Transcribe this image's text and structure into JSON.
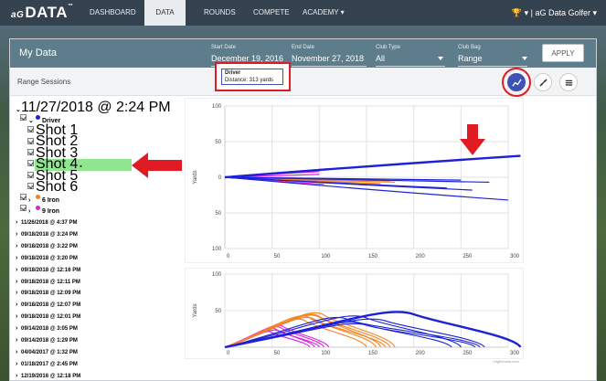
{
  "nav": {
    "logo_small": "aG",
    "logo_main": "DATA",
    "logo_mark": "™",
    "items": [
      "DASHBOARD",
      "DATA",
      "ROUNDS",
      "COMPETE",
      "ACADEMY ▾"
    ],
    "active_index": 1,
    "user": "🏆 ▾ | aG Data Golfer ▾"
  },
  "header": {
    "title": "My Data",
    "start_label": "Start Date",
    "start_value": "December 19, 2016",
    "end_label": "End Date",
    "end_value": "November 27, 2018",
    "club_type_label": "Club Type",
    "club_type_value": "All",
    "club_bag_label": "Club Bag",
    "club_bag_value": "Range",
    "apply_label": "APPLY"
  },
  "subbar": {
    "label": "Range Sessions",
    "icons": [
      "line-chart-icon",
      "scatter-icon",
      "list-icon"
    ]
  },
  "tree": {
    "session": "11/27/2018 @ 2:24 PM",
    "driver_label": "Driver",
    "shots": [
      "Shot 1",
      "Shot 2",
      "Shot 3",
      "Shot 4",
      "Shot 5",
      "Shot 6"
    ],
    "selected_shot_index": 3,
    "iron6_label": "6 Iron",
    "iron9_label": "9 Iron",
    "other_sessions": [
      "11/26/2018 @ 4:37 PM",
      "09/18/2018 @ 3:24 PM",
      "09/18/2018 @ 3:22 PM",
      "09/18/2018 @ 3:20 PM",
      "09/18/2018 @ 12:16 PM",
      "09/18/2018 @ 12:11 PM",
      "09/18/2018 @ 12:09 PM",
      "09/18/2018 @ 12:07 PM",
      "09/18/2018 @ 12:01 PM",
      "09/14/2018 @ 3:05 PM",
      "09/14/2018 @ 1:29 PM",
      "04/04/2017 @ 1:32 PM",
      "01/18/2017 @ 2:45 PM",
      "12/19/2016 @ 12:18 PM"
    ],
    "colors": {
      "driver": "#1e22d6",
      "iron6": "#f58220",
      "iron9": "#e020e0"
    }
  },
  "chart_data": [
    {
      "type": "line",
      "title": "",
      "ylabel": "Yards",
      "x_ticks": [
        "0",
        "50",
        "100",
        "150",
        "200",
        "250",
        "300"
      ],
      "y_ticks": [
        "100",
        "50",
        "0",
        "50",
        "100"
      ],
      "xlim": [
        0,
        300
      ],
      "ylim": [
        -100,
        100
      ],
      "tooltip": {
        "club": "Driver",
        "text": "Distance: 313 yards"
      },
      "series": [
        {
          "name": "Driver",
          "color": "#1e22d6",
          "lines": [
            [
              [
                0,
                0
              ],
              [
                313,
                30
              ]
            ],
            [
              [
                0,
                0
              ],
              [
                250,
                -4
              ]
            ],
            [
              [
                0,
                0
              ],
              [
                280,
                -7
              ]
            ],
            [
              [
                0,
                0
              ],
              [
                300,
                -32
              ]
            ],
            [
              [
                0,
                0
              ],
              [
                262,
                -18
              ]
            ],
            [
              [
                0,
                0
              ],
              [
                235,
                -15
              ]
            ]
          ]
        },
        {
          "name": "6 Iron",
          "color": "#f58220",
          "lines": [
            [
              [
                0,
                0
              ],
              [
                175,
                -5
              ]
            ],
            [
              [
                0,
                0
              ],
              [
                165,
                -9
              ]
            ],
            [
              [
                0,
                0
              ],
              [
                180,
                -7
              ]
            ],
            [
              [
                0,
                0
              ],
              [
                155,
                -11
              ]
            ],
            [
              [
                0,
                0
              ],
              [
                170,
                -3
              ]
            ]
          ]
        },
        {
          "name": "9 Iron",
          "color": "#e020e0",
          "lines": [
            [
              [
                0,
                0
              ],
              [
                110,
                12
              ]
            ],
            [
              [
                0,
                0
              ],
              [
                100,
                8
              ]
            ],
            [
              [
                0,
                0
              ],
              [
                105,
                -10
              ]
            ],
            [
              [
                0,
                0
              ],
              [
                95,
                -5
              ]
            ],
            [
              [
                0,
                0
              ],
              [
                100,
                4
              ]
            ]
          ]
        }
      ]
    },
    {
      "type": "line",
      "title": "",
      "ylabel": "Yards",
      "x_ticks": [
        "0",
        "50",
        "100",
        "150",
        "200",
        "250",
        "300"
      ],
      "y_ticks": [
        "100",
        "50"
      ],
      "xlim": [
        0,
        300
      ],
      "ylim": [
        0,
        100
      ],
      "credit": "Highcharts.com",
      "series": [
        {
          "name": "Driver",
          "color": "#1e22d6",
          "apex": [
            [
              313,
              45,
              200
            ],
            [
              270,
              38,
              130
            ],
            [
              250,
              40,
              150
            ],
            [
              240,
              32,
              145
            ],
            [
              275,
              36,
              170
            ],
            [
              265,
              30,
              150
            ]
          ]
        },
        {
          "name": "6 Iron",
          "color": "#f58220",
          "apex": [
            [
              175,
              42,
              100
            ],
            [
              160,
              40,
              90
            ],
            [
              170,
              38,
              95
            ],
            [
              180,
              44,
              105
            ],
            [
              150,
              36,
              85
            ],
            [
              165,
              41,
              100
            ]
          ]
        },
        {
          "name": "9 Iron",
          "color": "#e020e0",
          "apex": [
            [
              105,
              26,
              60
            ],
            [
              95,
              24,
              55
            ],
            [
              110,
              28,
              62
            ],
            [
              100,
              22,
              58
            ],
            [
              90,
              20,
              50
            ]
          ]
        }
      ]
    }
  ]
}
